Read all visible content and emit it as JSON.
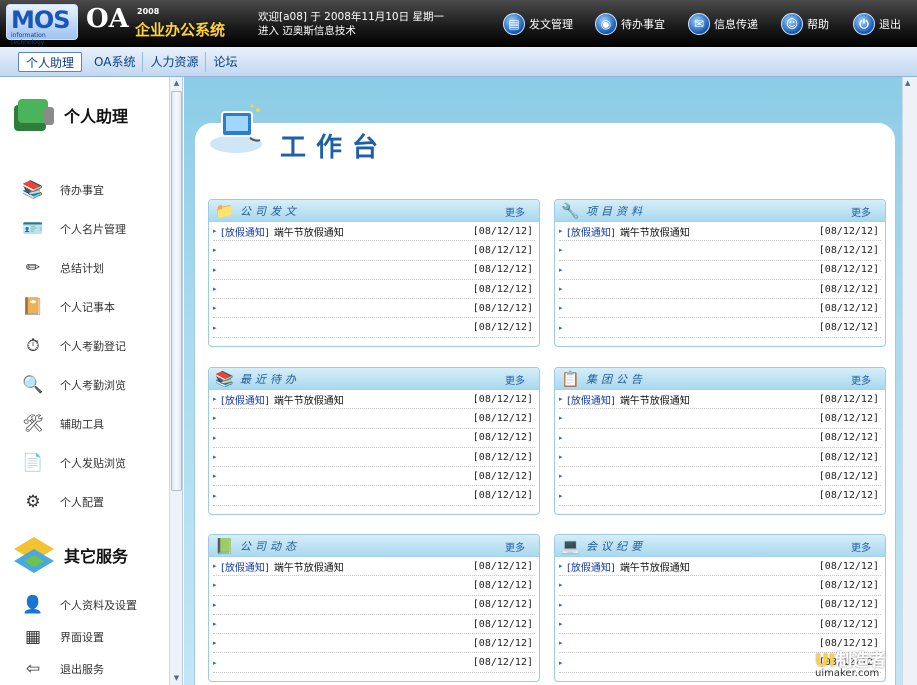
{
  "header": {
    "logo_mos": "MOS",
    "logo_it": "information technology",
    "logo_oa": "OA",
    "logo_year": "2008",
    "logo_sys": "企业办公系统",
    "welcome_line1": "欢迎[a08] 于 2008年11月10日 星期一",
    "welcome_line2": "进入 迈奥斯信息技术",
    "buttons": [
      {
        "label": "发文管理",
        "icon": "document-icon"
      },
      {
        "label": "待办事宜",
        "icon": "todo-icon"
      },
      {
        "label": "信息传递",
        "icon": "mail-icon"
      },
      {
        "label": "帮助",
        "icon": "help-icon"
      },
      {
        "label": "退出",
        "icon": "power-icon"
      }
    ]
  },
  "nav": {
    "tabs": [
      {
        "label": "个人助理",
        "active": true
      },
      {
        "label": "OA系统"
      },
      {
        "label": "人力资源"
      },
      {
        "label": "论坛"
      }
    ]
  },
  "sidebar": {
    "section1_title": "个人助理",
    "section2_title": "其它服务",
    "items1": [
      {
        "label": "待办事宜",
        "icon": "books-icon"
      },
      {
        "label": "个人名片管理",
        "icon": "card-icon"
      },
      {
        "label": "总结计划",
        "icon": "pencil-icon"
      },
      {
        "label": "个人记事本",
        "icon": "notebook-icon"
      },
      {
        "label": "个人考勤登记",
        "icon": "stopwatch-icon"
      },
      {
        "label": "个人考勤浏览",
        "icon": "magnifier-icon"
      },
      {
        "label": "辅助工具",
        "icon": "tools-icon"
      },
      {
        "label": "个人发贴浏览",
        "icon": "post-icon"
      },
      {
        "label": "个人配置",
        "icon": "config-icon"
      }
    ],
    "items2": [
      {
        "label": "个人资料及设置",
        "icon": "profile-icon"
      },
      {
        "label": "界面设置",
        "icon": "interface-icon"
      },
      {
        "label": "退出服务",
        "icon": "logout-icon"
      }
    ]
  },
  "main": {
    "title": "工作台",
    "more_label": "更多",
    "panels": [
      {
        "title": "公司发文",
        "icon": "folder-icon",
        "rows": [
          {
            "tag": "[放假通知]",
            "text": "端午节放假通知",
            "date": "[08/12/12]"
          },
          {
            "tag": "",
            "text": "",
            "date": "[08/12/12]"
          },
          {
            "tag": "",
            "text": "",
            "date": "[08/12/12]"
          },
          {
            "tag": "",
            "text": "",
            "date": "[08/12/12]"
          },
          {
            "tag": "",
            "text": "",
            "date": "[08/12/12]"
          },
          {
            "tag": "",
            "text": "",
            "date": "[08/12/12]"
          }
        ]
      },
      {
        "title": "项目资料",
        "icon": "tools-icon",
        "rows": [
          {
            "tag": "[放假通知]",
            "text": "端午节放假通知",
            "date": "[08/12/12]"
          },
          {
            "tag": "",
            "text": "",
            "date": "[08/12/12]"
          },
          {
            "tag": "",
            "text": "",
            "date": "[08/12/12]"
          },
          {
            "tag": "",
            "text": "",
            "date": "[08/12/12]"
          },
          {
            "tag": "",
            "text": "",
            "date": "[08/12/12]"
          },
          {
            "tag": "",
            "text": "",
            "date": "[08/12/12]"
          }
        ]
      },
      {
        "title": "最近待办",
        "icon": "books-icon",
        "rows": [
          {
            "tag": "[放假通知]",
            "text": "端午节放假通知",
            "date": "[08/12/12]"
          },
          {
            "tag": "",
            "text": "",
            "date": "[08/12/12]"
          },
          {
            "tag": "",
            "text": "",
            "date": "[08/12/12]"
          },
          {
            "tag": "",
            "text": "",
            "date": "[08/12/12]"
          },
          {
            "tag": "",
            "text": "",
            "date": "[08/12/12]"
          },
          {
            "tag": "",
            "text": "",
            "date": "[08/12/12]"
          }
        ]
      },
      {
        "title": "集团公告",
        "icon": "notice-icon",
        "rows": [
          {
            "tag": "[放假通知]",
            "text": "端午节放假通知",
            "date": "[08/12/12]"
          },
          {
            "tag": "",
            "text": "",
            "date": "[08/12/12]"
          },
          {
            "tag": "",
            "text": "",
            "date": "[08/12/12]"
          },
          {
            "tag": "",
            "text": "",
            "date": "[08/12/12]"
          },
          {
            "tag": "",
            "text": "",
            "date": "[08/12/12]"
          },
          {
            "tag": "",
            "text": "",
            "date": "[08/12/12]"
          }
        ]
      },
      {
        "title": "公司动态",
        "icon": "stack-icon",
        "rows": [
          {
            "tag": "[放假通知]",
            "text": "端午节放假通知",
            "date": "[08/12/12]"
          },
          {
            "tag": "",
            "text": "",
            "date": "[08/12/12]"
          },
          {
            "tag": "",
            "text": "",
            "date": "[08/12/12]"
          },
          {
            "tag": "",
            "text": "",
            "date": "[08/12/12]"
          },
          {
            "tag": "",
            "text": "",
            "date": "[08/12/12]"
          },
          {
            "tag": "",
            "text": "",
            "date": "[08/12/12]"
          }
        ]
      },
      {
        "title": "会议纪要",
        "icon": "laptop-icon",
        "rows": [
          {
            "tag": "[放假通知]",
            "text": "端午节放假通知",
            "date": "[08/12/12]"
          },
          {
            "tag": "",
            "text": "",
            "date": "[08/12/12]"
          },
          {
            "tag": "",
            "text": "",
            "date": "[08/12/12]"
          },
          {
            "tag": "",
            "text": "",
            "date": "[08/12/12]"
          },
          {
            "tag": "",
            "text": "",
            "date": "[08/12/12]"
          },
          {
            "tag": "",
            "text": "",
            "date": "[08/12/12]"
          }
        ]
      }
    ]
  },
  "watermark": {
    "part1": "UI",
    "part2": "制造者",
    "url": "uimaker.com"
  },
  "colors": {
    "header_bg": "#1c1c1c",
    "nav_bg": "#c2d8f0",
    "main_bg": "#a9daef",
    "accent": "#1f5ea9",
    "tag": "#1238a8"
  }
}
